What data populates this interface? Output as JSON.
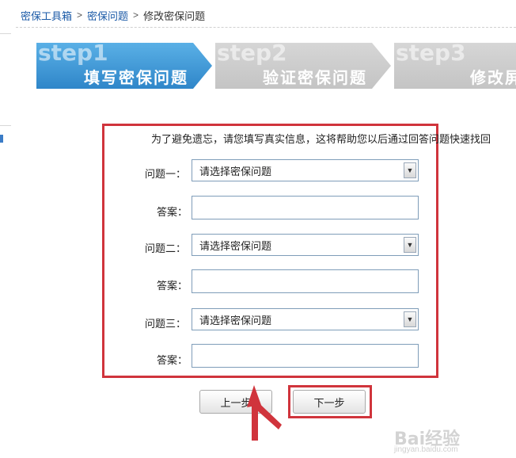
{
  "breadcrumb": {
    "items": [
      "密保工具箱",
      "密保问题",
      "修改密保问题"
    ],
    "separator": ">"
  },
  "steps": [
    {
      "number": "step1",
      "label": "填写密保问题",
      "active": true
    },
    {
      "number": "step2",
      "label": "验证密保问题",
      "active": false
    },
    {
      "number": "step3",
      "label": "修改屏",
      "active": false
    }
  ],
  "form": {
    "intro": "为了避免遗忘，请您填写真实信息，这将帮助您以后通过回答问题快速找回",
    "q1_label": "问题一：",
    "q2_label": "问题二：",
    "q3_label": "问题三：",
    "answer_label": "答案：",
    "select_placeholder": "请选择密保问题"
  },
  "buttons": {
    "prev": "上一步",
    "next": "下一步"
  },
  "colors": {
    "accent": "#2f86c9",
    "highlight": "#d0343c",
    "link": "#1b5aa7"
  },
  "watermark": {
    "logo": "Bai经验",
    "url": "jingyan.baidu.com"
  }
}
